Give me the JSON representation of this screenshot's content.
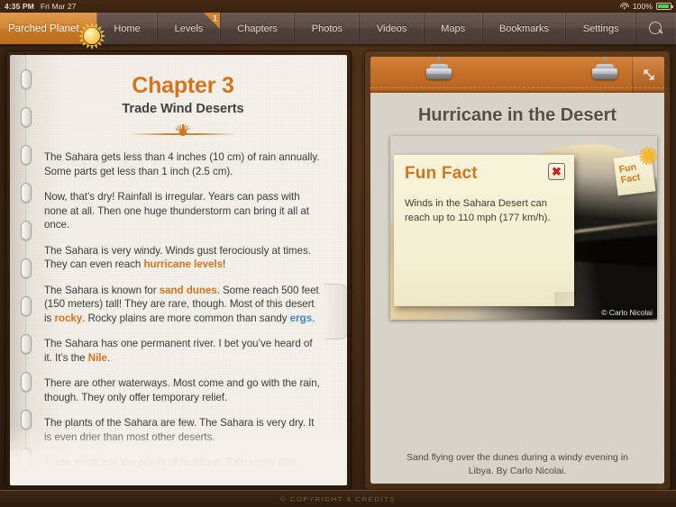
{
  "statusbar": {
    "time": "4:35 PM",
    "date": "Fri Mar 27",
    "battery_percent": "100%",
    "wifi_icon": "wifi-icon",
    "battery_icon": "battery-icon"
  },
  "nav": {
    "brand": "Parched Planet",
    "brand_icon": "sun-icon",
    "tabs": [
      {
        "label": "Home",
        "badge": null
      },
      {
        "label": "Levels",
        "badge": "1"
      },
      {
        "label": "Chapters",
        "badge": null
      },
      {
        "label": "Photos",
        "badge": null
      },
      {
        "label": "Videos",
        "badge": null
      },
      {
        "label": "Maps",
        "badge": null
      },
      {
        "label": "Bookmarks",
        "badge": null
      },
      {
        "label": "Settings",
        "badge": null
      }
    ],
    "search_icon": "search-icon"
  },
  "book": {
    "chapter_title": "Chapter 3",
    "chapter_subtitle": "Trade Wind Deserts",
    "divider_icon": "sun-horizon-ornament",
    "paragraphs": [
      {
        "runs": [
          {
            "text": "The Sahara gets less than 4 inches (10 cm) of rain annually. Some parts get less than 1 inch (2.5 cm).",
            "style": "normal"
          }
        ]
      },
      {
        "runs": [
          {
            "text": "Now, that’s dry! Rainfall is irregular. Years can pass with none at all. Then one huge thunderstorm can bring it all at once.",
            "style": "normal"
          }
        ]
      },
      {
        "runs": [
          {
            "text": "The Sahara is very windy. Winds gust ferociously at times. They can even reach ",
            "style": "normal"
          },
          {
            "text": "hurricane levels",
            "style": "link-orange"
          },
          {
            "text": "!",
            "style": "normal"
          }
        ]
      },
      {
        "runs": [
          {
            "text": "The Sahara is known for ",
            "style": "normal"
          },
          {
            "text": "sand dunes",
            "style": "link-orange"
          },
          {
            "text": ". Some reach 500 feet (150 meters) tall! They are rare, though. Most of this desert is ",
            "style": "normal"
          },
          {
            "text": "rocky",
            "style": "link-orange"
          },
          {
            "text": ". Rocky plains are more common than sandy ",
            "style": "normal"
          },
          {
            "text": "ergs",
            "style": "link-blue"
          },
          {
            "text": ".",
            "style": "normal"
          }
        ]
      },
      {
        "runs": [
          {
            "text": "The Sahara has one permanent river. I bet you’ve heard of it. It’s the ",
            "style": "normal"
          },
          {
            "text": "Nile",
            "style": "link-orange"
          },
          {
            "text": ".",
            "style": "normal"
          }
        ]
      },
      {
        "runs": [
          {
            "text": "There are other waterways. Most come and go with the rain, though. They only offer temporary relief.",
            "style": "normal"
          }
        ]
      },
      {
        "runs": [
          {
            "text": "The plants of the Sahara are few. The Sahara is very dry. It is even drier than most other deserts.",
            "style": "normal"
          }
        ]
      },
      {
        "runs": [
          {
            "text": "Trade winds rob the plants of moisture. Rain rarely falls.",
            "style": "normal"
          }
        ]
      }
    ],
    "page_tab_name": "page-pull-tab"
  },
  "panel": {
    "clip_left_icon": "binder-clip-icon",
    "clip_right_icon": "binder-clip-icon",
    "expand_icon": "expand-arrows-icon",
    "artwork_title": "Hurricane in the Desert",
    "photo_credit": "© Carlo Nicolai",
    "caption": "Sand flying over the dunes during a windy evening in Libya. By Carlo Nicolai.",
    "sticky": {
      "title": "Fun Fact",
      "close_icon": "close-x-icon",
      "close_glyph": "✖",
      "text": "Winds in the Sahara Desert can reach up to 110 mph (177 km/h)."
    },
    "fun_tag": {
      "line1": "Fun",
      "line2": "Fact",
      "sun_icon": "sun-icon"
    }
  },
  "footer": {
    "text": "© COPYRIGHT & CREDITS"
  },
  "colors": {
    "brand_orange": "#d4862f",
    "link_orange": "#d4741c",
    "link_blue": "#3d86c6",
    "wood_brown": "#4a2f17",
    "battery_green": "#4ad24a"
  }
}
